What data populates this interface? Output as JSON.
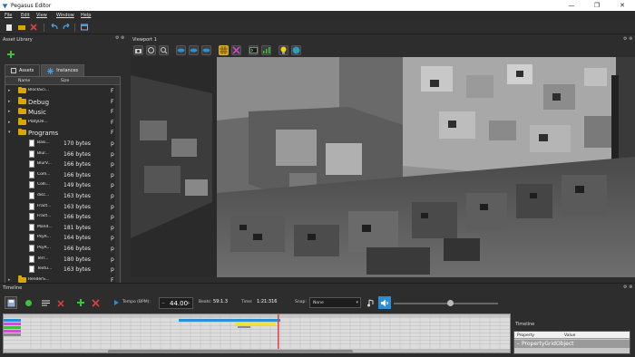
{
  "window": {
    "title": "Pegasus Editor",
    "minimize": "—",
    "maximize": "❐",
    "close": "✕"
  },
  "menu": [
    "File",
    "Edit",
    "View",
    "Window",
    "Help"
  ],
  "asset_library": {
    "title": "Asset Library",
    "tabs": [
      "Assets",
      "Instances"
    ],
    "columns": {
      "name": "Name",
      "size": "Size"
    },
    "rows": [
      {
        "type": "folder",
        "name": "BlockSci...",
        "depth": 0,
        "f": "F"
      },
      {
        "type": "folder",
        "name": "Debug",
        "depth": 0,
        "f": "F",
        "large": true
      },
      {
        "type": "folder",
        "name": "Music",
        "depth": 0,
        "f": "F",
        "large": true
      },
      {
        "type": "folder",
        "name": "PlatyDe...",
        "depth": 0,
        "f": "F"
      },
      {
        "type": "folder",
        "name": "Programs",
        "depth": 0,
        "f": "F",
        "large": true,
        "expanded": true
      },
      {
        "type": "file",
        "name": "Basi...",
        "size": "170 bytes",
        "f": "p"
      },
      {
        "type": "file",
        "name": "Blur...",
        "size": "166 bytes",
        "f": "p"
      },
      {
        "type": "file",
        "name": "BlurV...",
        "size": "166 bytes",
        "f": "p"
      },
      {
        "type": "file",
        "name": "Com...",
        "size": "166 bytes",
        "f": "p"
      },
      {
        "type": "file",
        "name": "Colli...",
        "size": "149 bytes",
        "f": "p"
      },
      {
        "type": "file",
        "name": "disc...",
        "size": "163 bytes",
        "f": "p"
      },
      {
        "type": "file",
        "name": "Fract...",
        "size": "163 bytes",
        "f": "p"
      },
      {
        "type": "file",
        "name": "Fract...",
        "size": "166 bytes",
        "f": "p"
      },
      {
        "type": "file",
        "name": "Mand...",
        "size": "181 bytes",
        "f": "p"
      },
      {
        "type": "file",
        "name": "PsyR...",
        "size": "164 bytes",
        "f": "p"
      },
      {
        "type": "file",
        "name": "PsyR...",
        "size": "166 bytes",
        "f": "p"
      },
      {
        "type": "file",
        "name": "Terr...",
        "size": "180 bytes",
        "f": "p"
      },
      {
        "type": "file",
        "name": "Textu...",
        "size": "163 bytes",
        "f": "p"
      },
      {
        "type": "folder",
        "name": "RenderS...",
        "depth": 0,
        "f": "F"
      },
      {
        "type": "folder",
        "name": "Shaders",
        "depth": 0,
        "f": "F",
        "large": true
      }
    ]
  },
  "viewport": {
    "title": "Viewport 1"
  },
  "timeline": {
    "title": "Timeline",
    "tempo_label": "Tempo (BPM):",
    "tempo_value": "44.00",
    "beats_label": "Beats:",
    "beats_value": "59:1.3",
    "time_label": "Time:",
    "time_value": "1:21:316",
    "snap_label": "Snap:",
    "snap_value": "None",
    "volume_level": 0.54
  },
  "properties": {
    "title": "Timeline",
    "col_property": "Property",
    "col_value": "Value",
    "row": "PropertyGridObject"
  },
  "colors": {
    "accent": "#2b8fd6",
    "folder": "#d8a800",
    "marker": "#e04040"
  }
}
